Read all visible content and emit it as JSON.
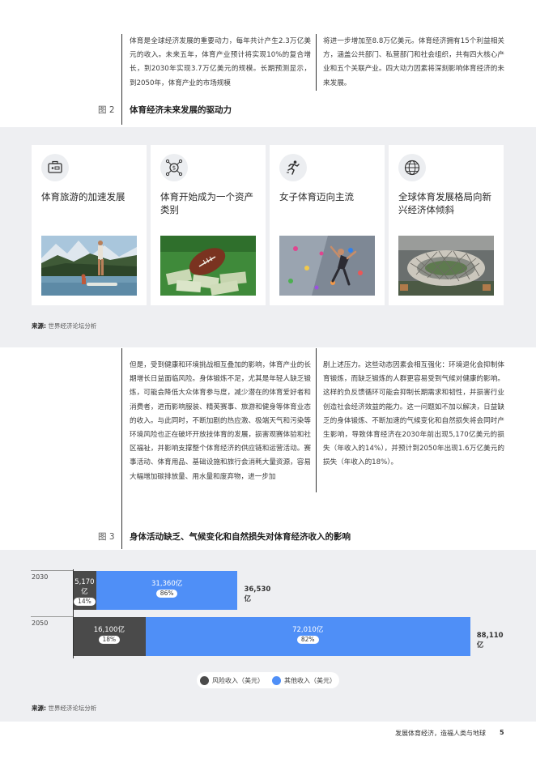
{
  "intro": {
    "left": "体育是全球经济发展的重要动力，每年共计产生2.3万亿美元的收入。未来五年，体育产业预计将实现10%的复合增长，到2030年实现3.7万亿美元的规模。长期预测显示，到2050年，体育产业的市场规模",
    "right": "将进一步增加至8.8万亿美元。体育经济拥有15个利益相关方，涵盖公共部门、私营部门和社会组织，共有四大核心产业和五个关联产业。四大动力因素将深刻影响体育经济的未来发展。"
  },
  "figure2": {
    "label": "图 2",
    "title": "体育经济未来发展的驱动力",
    "cards": [
      {
        "title": "体育旅游的加速发展",
        "icon": "suitcase-icon"
      },
      {
        "title": "体育开始成为一个资产类别",
        "icon": "money-network-icon"
      },
      {
        "title": "女子体育迈向主流",
        "icon": "runner-icon"
      },
      {
        "title": "全球体育发展格局向新兴经济体倾斜",
        "icon": "globe-icon"
      }
    ],
    "source_label": "来源:",
    "source_text": "世界经济论坛分析"
  },
  "body2": {
    "left": "但是，受到健康和环境挑战相互叠加的影响，体育产业的长期增长日益面临风险。身体锻炼不足，尤其是年轻人缺乏锻炼，可能会降低大众体育参与度，减少潜在的体育爱好者和消费者，进而影响服装、精英赛事、旅游和健身等体育业态的收入。与此同时，不断加剧的热应激、极端天气和污染等环境风险也正在破坏开放技体育的发展，损害观赛体验和社区福祉，并影响支撑整个体育经济的供应链和运营活动。赛事活动、体育用品、基础设施和旅行会消耗大量资源，容易大幅增加碳排放量、用水量和废弃物，进一步加",
    "right": "剧上述压力。这些动态因素会相互强化：环境退化会抑制体育锻炼，而缺乏锻炼的人群更容易受到气候对健康的影响。这样的负反馈循环可能会抑制长期需求和韧性，并损害行业创造社会经济效益的能力。这一问题如不加以解决，日益缺乏的身体锻炼、不断加速的气候变化和自然损失将会同时产生影响，导致体育经济在2030年前出现5,170亿美元的损失（年收入的14%），并预计到2050年出现1.6万亿美元的损失（年收入的18%）。"
  },
  "figure3": {
    "label": "图 3",
    "title": "身体活动缺乏、气候变化和自然损失对体育经济收入的影响",
    "source_label": "来源:",
    "source_text": "世界经济论坛分析"
  },
  "chart_data": {
    "type": "bar",
    "orientation": "horizontal",
    "stacked": true,
    "categories": [
      "2030",
      "2050"
    ],
    "series": [
      {
        "name": "风险收入（美元）",
        "values": [
          5170,
          16100
        ],
        "value_labels": [
          "5,170亿",
          "16,100亿"
        ],
        "pct_labels": [
          "14%",
          "18%"
        ],
        "color": "#4a4a4a"
      },
      {
        "name": "其他收入（美元）",
        "values": [
          31360,
          72010
        ],
        "value_labels": [
          "31,360亿",
          "72,010亿"
        ],
        "pct_labels": [
          "86%",
          "82%"
        ],
        "color": "#4f8ff7"
      }
    ],
    "totals": [
      "36,530亿",
      "88,110亿"
    ],
    "legend": "bottom-center"
  },
  "footer": {
    "text": "发展体育经济，造福人类与地球",
    "page": "5"
  }
}
